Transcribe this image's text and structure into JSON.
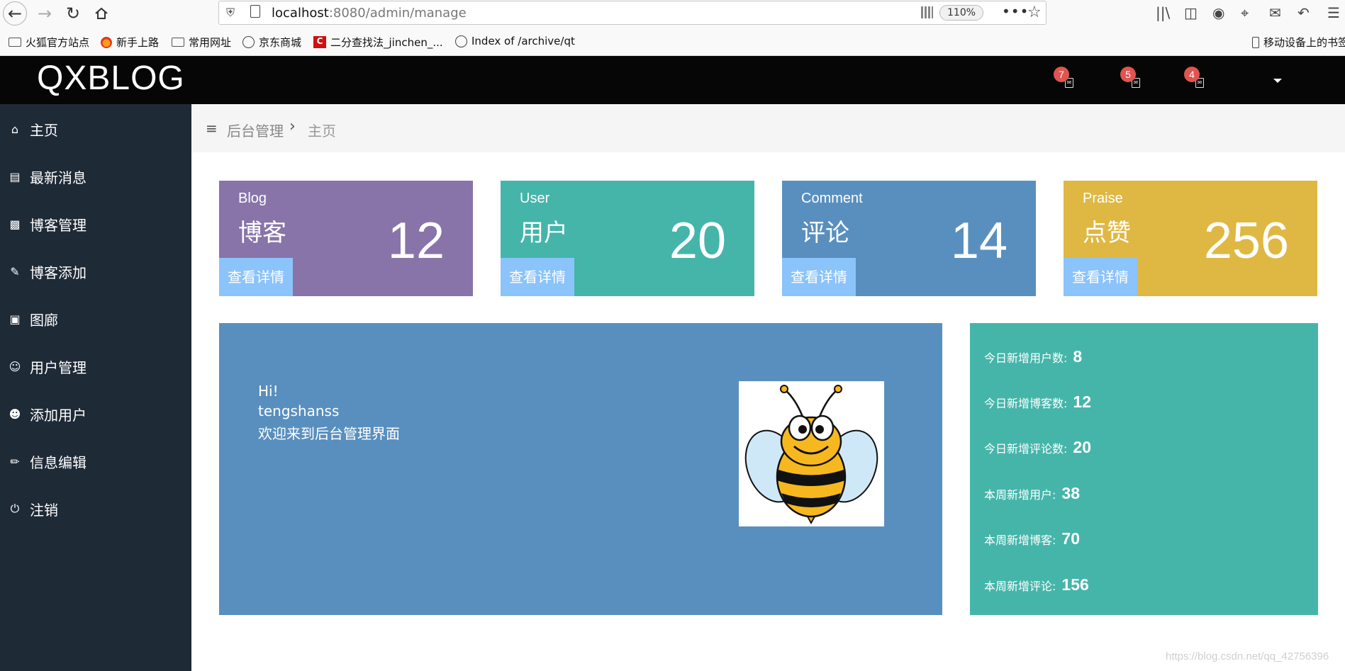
{
  "browser": {
    "url_host": "localhost",
    "url_path": ":8080/admin/manage",
    "zoom": "110%",
    "bookmarks": [
      "火狐官方站点",
      "新手上路",
      "常用网址",
      "京东商城",
      "二分查找法_jinchen_...",
      "Index of /archive/qt"
    ],
    "mobile_bookmarks": "移动设备上的书签"
  },
  "header": {
    "brand": "QXBLOG",
    "notifications": [
      {
        "count": "7",
        "icon": "mail-icon"
      },
      {
        "count": "5",
        "icon": "task-icon"
      },
      {
        "count": "4",
        "icon": "alert-icon"
      }
    ]
  },
  "sidebar": {
    "items": [
      {
        "label": "主页",
        "icon": "home-icon"
      },
      {
        "label": "最新消息",
        "icon": "message-icon"
      },
      {
        "label": "博客管理",
        "icon": "blog-manage-icon"
      },
      {
        "label": "博客添加",
        "icon": "blog-add-icon"
      },
      {
        "label": "图廊",
        "icon": "image-icon"
      },
      {
        "label": "用户管理",
        "icon": "user-icon"
      },
      {
        "label": "添加用户",
        "icon": "user-add-icon"
      },
      {
        "label": "信息编辑",
        "icon": "edit-icon"
      },
      {
        "label": "注销",
        "icon": "power-icon"
      }
    ]
  },
  "breadcrumb": {
    "parent": "后台管理",
    "current": "主页"
  },
  "cards": [
    {
      "en": "Blog",
      "cn": "博客",
      "count": "12",
      "detail": "查看详情",
      "color": "#8874a8"
    },
    {
      "en": "User",
      "cn": "用户",
      "count": "20",
      "detail": "查看详情",
      "color": "#45b5aa"
    },
    {
      "en": "Comment",
      "cn": "评论",
      "count": "14",
      "detail": "查看详情",
      "color": "#598fbe"
    },
    {
      "en": "Praise",
      "cn": "点赞",
      "count": "256",
      "detail": "查看详情",
      "color": "#dfb843"
    }
  ],
  "welcome": {
    "greeting": "Hi!",
    "username": "tengshanss",
    "message": "欢迎来到后台管理界面"
  },
  "stats": [
    {
      "label": "今日新增用户数:",
      "value": "8"
    },
    {
      "label": "今日新增博客数:",
      "value": "12"
    },
    {
      "label": "今日新增评论数:",
      "value": "20"
    },
    {
      "label": "本周新增用户:",
      "value": "38"
    },
    {
      "label": "本周新增博客:",
      "value": "70"
    },
    {
      "label": "本周新增评论:",
      "value": "156"
    }
  ],
  "watermark": "https://blog.csdn.net/qq_42756396"
}
